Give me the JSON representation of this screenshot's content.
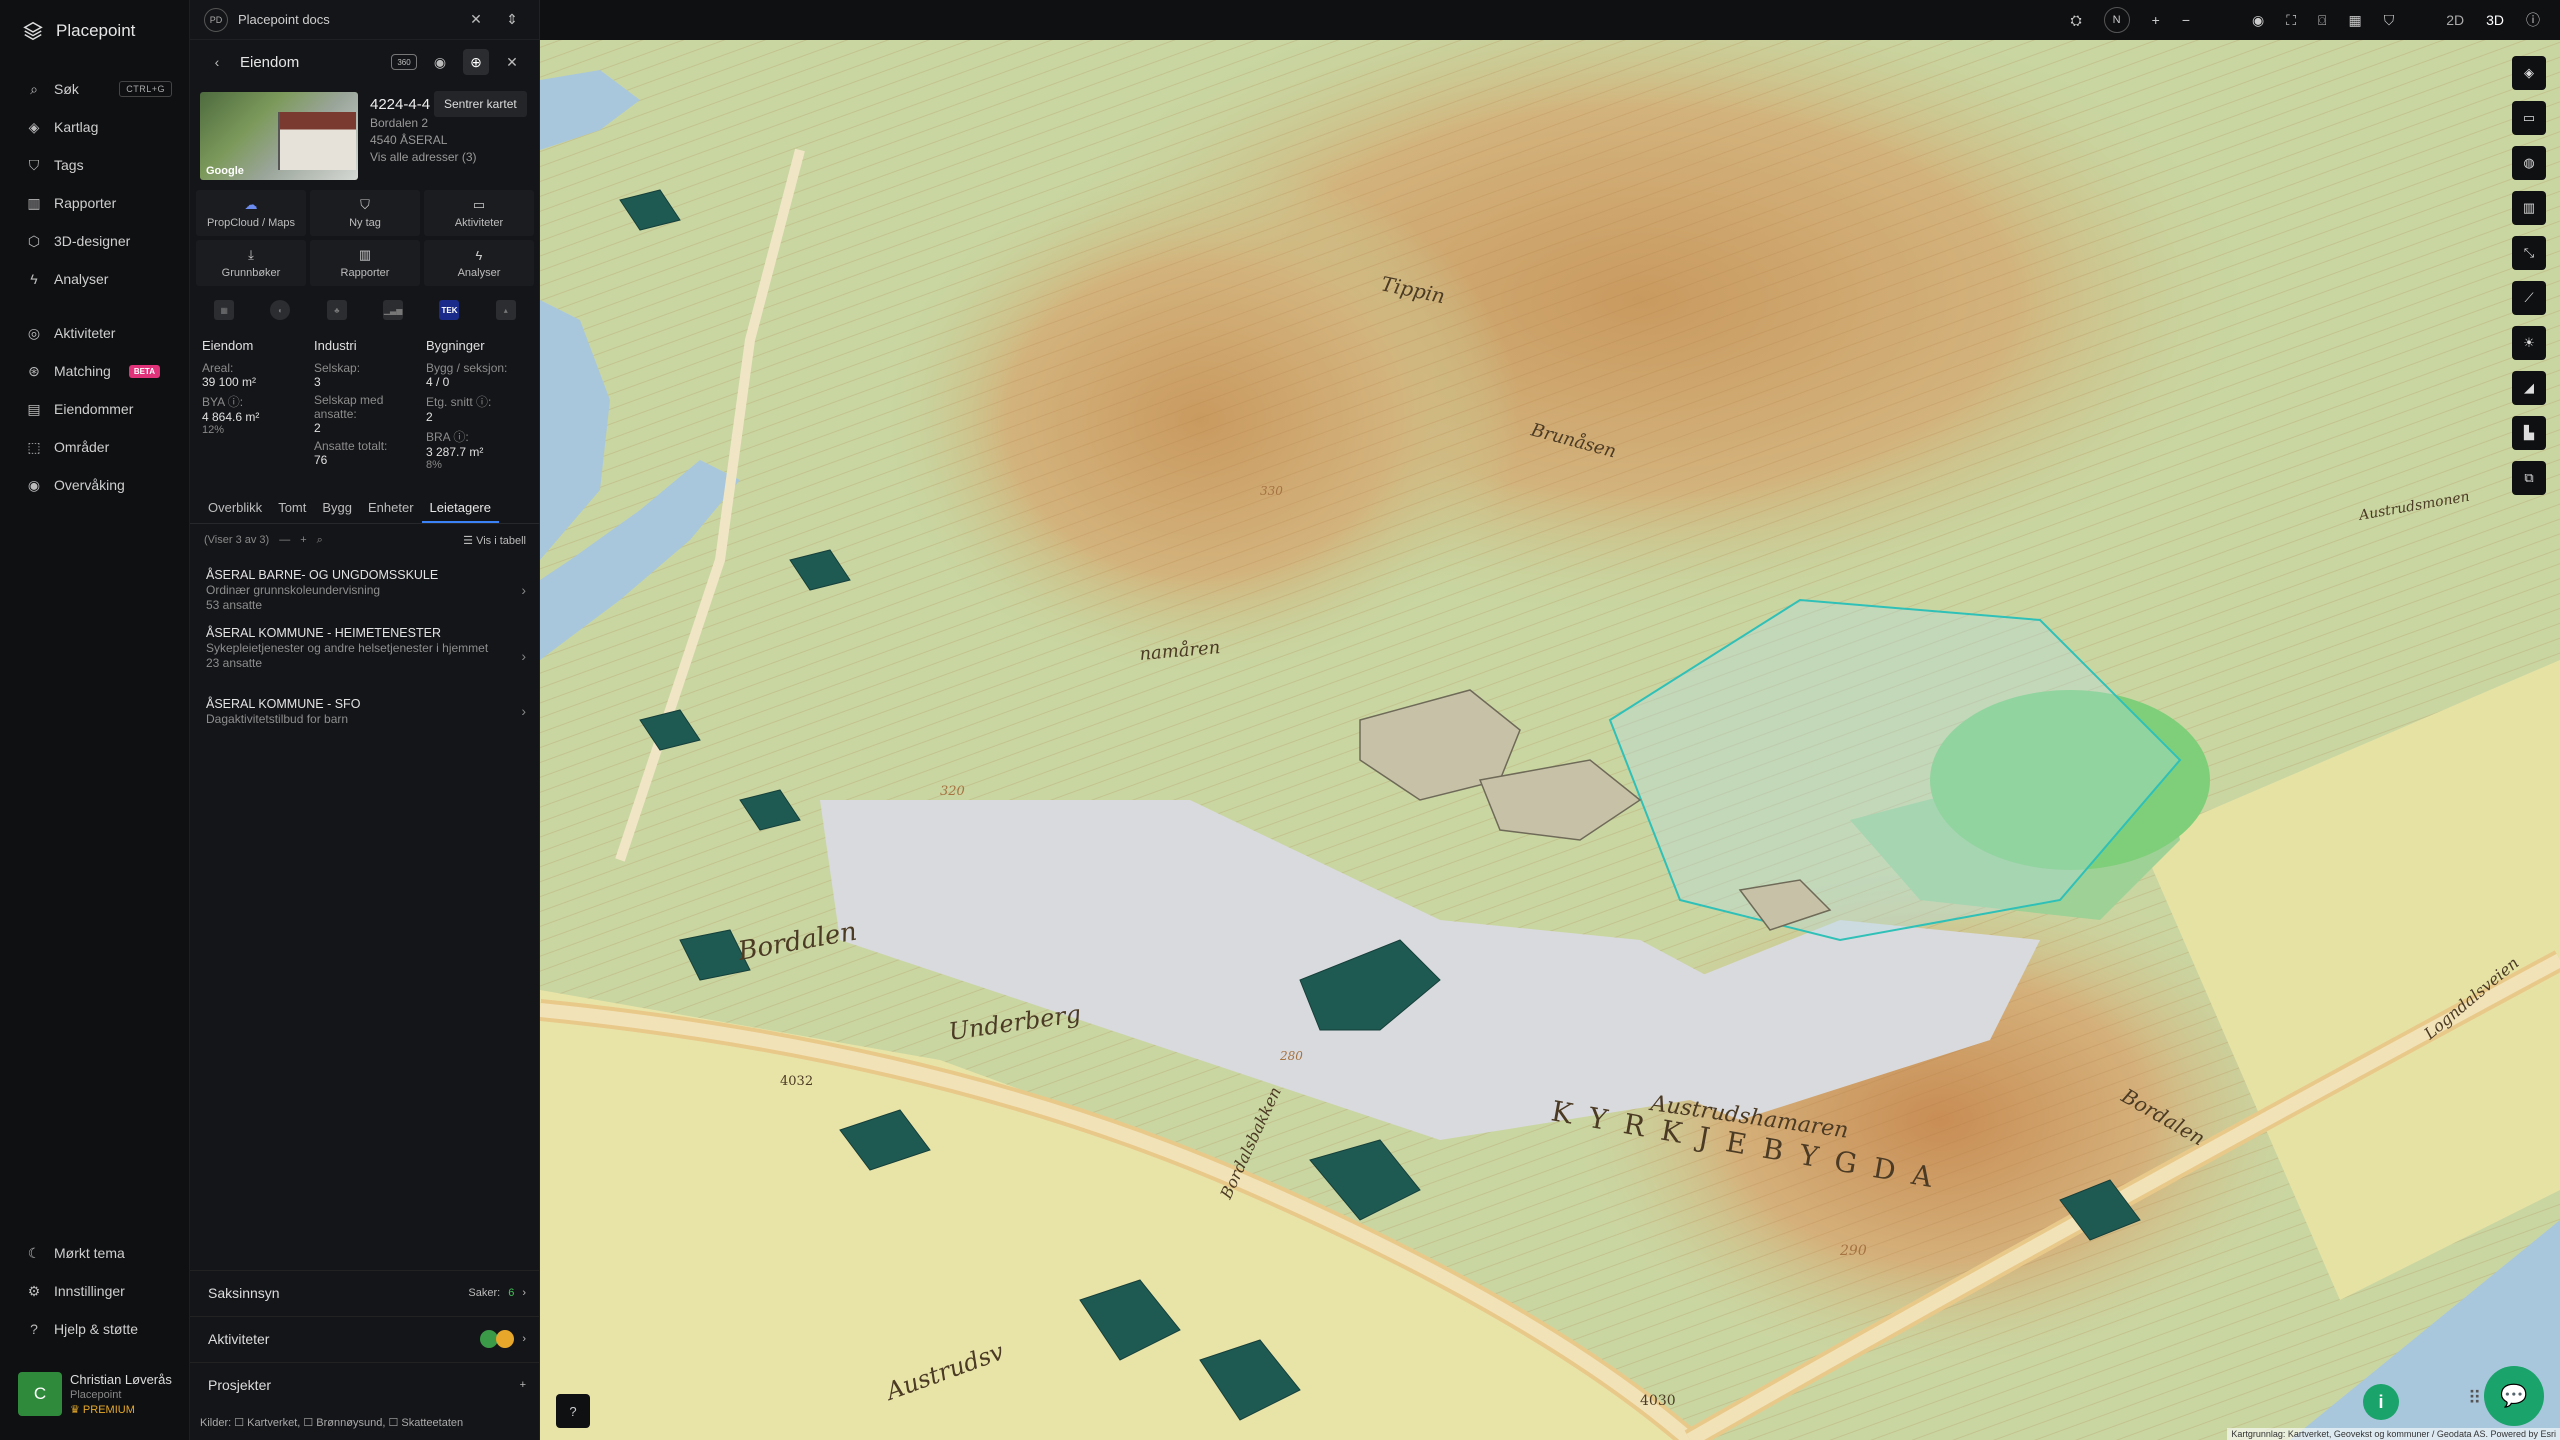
{
  "app": {
    "name": "Placepoint"
  },
  "nav": {
    "items": [
      {
        "label": "Søk",
        "icon": "search-icon",
        "shortcut": "CTRL+G"
      },
      {
        "label": "Kartlag",
        "icon": "layers-icon"
      },
      {
        "label": "Tags",
        "icon": "bookmark-icon"
      },
      {
        "label": "Rapporter",
        "icon": "chart-icon"
      },
      {
        "label": "3D-designer",
        "icon": "cube-icon"
      },
      {
        "label": "Analyser",
        "icon": "bolt-icon"
      }
    ],
    "items2": [
      {
        "label": "Aktiviteter",
        "icon": "chat-icon"
      },
      {
        "label": "Matching",
        "icon": "match-icon",
        "badge": "BETA"
      },
      {
        "label": "Eiendommer",
        "icon": "document-icon"
      },
      {
        "label": "Områder",
        "icon": "area-icon"
      },
      {
        "label": "Overvåking",
        "icon": "eye-icon"
      }
    ],
    "bottom": [
      {
        "label": "Mørkt tema",
        "icon": "moon-icon"
      },
      {
        "label": "Innstillinger",
        "icon": "gear-icon"
      },
      {
        "label": "Hjelp & støtte",
        "icon": "help-icon"
      }
    ],
    "user": {
      "initial": "C",
      "name": "Christian Løverås",
      "org": "Placepoint",
      "plan": "PREMIUM"
    }
  },
  "panel": {
    "top": {
      "badge": "PD",
      "title": "Placepoint docs"
    },
    "header": {
      "title": "Eiendom",
      "tooltip": "Sentrer kartet",
      "badge360": "360"
    },
    "property": {
      "id": "4224-4-4",
      "street": "Bordalen 2",
      "post": "4540 ÅSERAL",
      "link": "Vis alle adresser (3)",
      "photo_credit": "Google"
    },
    "quick": [
      {
        "label": "PropCloud / Maps",
        "icon": "cloud-icon"
      },
      {
        "label": "Ny tag",
        "icon": "bookmark-icon"
      },
      {
        "label": "Aktiviteter",
        "icon": "chat-icon"
      },
      {
        "label": "Grunnbøker",
        "icon": "download-icon"
      },
      {
        "label": "Rapporter",
        "icon": "chart-icon"
      },
      {
        "label": "Analyser",
        "icon": "bolt-icon"
      }
    ],
    "source_tek": "TEK",
    "stats": {
      "eiendom": {
        "title": "Eiendom",
        "areal_k": "Areal:",
        "areal_v": "39 100 m²",
        "bya_k": "BYA ⓘ:",
        "bya_v": "4 864.6 m²",
        "bya_pct": "12%"
      },
      "industri": {
        "title": "Industri",
        "selskap_k": "Selskap:",
        "selskap_v": "3",
        "ansatte_k": "Selskap med ansatte:",
        "ansatte_v": "2",
        "total_k": "Ansatte totalt:",
        "total_v": "76"
      },
      "bygninger": {
        "title": "Bygninger",
        "bygg_k": "Bygg / seksjon:",
        "bygg_v": "4 / 0",
        "etg_k": "Etg. snitt ⓘ:",
        "etg_v": "2",
        "bra_k": "BRA ⓘ:",
        "bra_v": "3 287.7 m²",
        "bra_pct": "8%"
      }
    },
    "tabs": [
      "Overblikk",
      "Tomt",
      "Bygg",
      "Enheter",
      "Leietagere"
    ],
    "active_tab": "Leietagere",
    "list": {
      "count": "(Viser 3 av 3)",
      "table": "Vis i tabell"
    },
    "tenants": [
      {
        "name": "ÅSERAL BARNE- OG UNGDOMSSKULE",
        "desc": "Ordinær grunnskoleundervisning",
        "emp": "53 ansatte"
      },
      {
        "name": "ÅSERAL KOMMUNE - HEIMETENESTER",
        "desc": "Sykepleietjenester og andre helsetjenester i hjemmet",
        "emp": "23 ansatte"
      },
      {
        "name": "ÅSERAL KOMMUNE - SFO",
        "desc": "Dagaktivitetstilbud for barn",
        "emp": ""
      }
    ],
    "sections": {
      "saksinnsyn": "Saksinnsyn",
      "saker_label": "Saker:",
      "saker_count": "6",
      "aktiviteter": "Aktiviteter",
      "prosjekter": "Prosjekter"
    },
    "sources_footer": "Kilder: ☐ Kartverket, ☐ Brønnøysund, ☐ Skatteetaten"
  },
  "map": {
    "toolbar": {
      "compass": "N",
      "mode2d": "2D",
      "mode3d": "3D"
    },
    "labels": {
      "tippin": "Tippin",
      "brunasen": "Brunåsen",
      "namaren": "namåren",
      "bordalen": "Bordalen",
      "underberg": "Underberg",
      "bordalsbakken": "Bordalsbakken",
      "austrud": "Austrudshamaren",
      "kyrkjebygda": "K Y R K J E B Y G D A",
      "bordalen2": "Bordalen",
      "austrudsv": "Austrudsv",
      "austrudsmonen": "Austrudsmonen",
      "logndalsveien": "Logndalsveien",
      "r4032": "4032",
      "r4030": "4030",
      "h320": "320",
      "h290": "290",
      "h280": "280",
      "h330": "330"
    },
    "attribution": "Kartgrunnlag: Kartverket, Geovekst og kommuner / Geodata AS. Powered by Esri"
  }
}
